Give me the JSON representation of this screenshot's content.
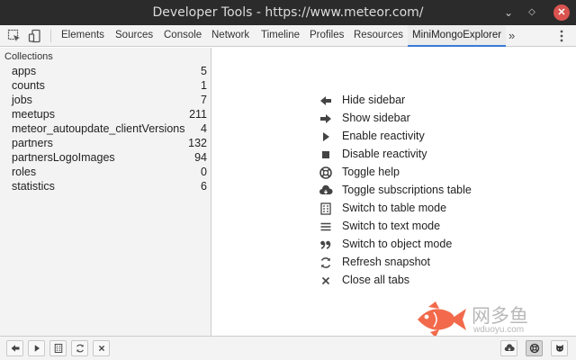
{
  "window": {
    "title": "Developer Tools - https://www.meteor.com/",
    "minimize_glyph": "⌄",
    "restore_glyph": "◇",
    "close_glyph": "✕"
  },
  "tabs": {
    "items": [
      {
        "label": "Elements"
      },
      {
        "label": "Sources"
      },
      {
        "label": "Console"
      },
      {
        "label": "Network"
      },
      {
        "label": "Timeline"
      },
      {
        "label": "Profiles"
      },
      {
        "label": "Resources"
      },
      {
        "label": "MiniMongoExplorer",
        "active": true
      }
    ],
    "more_glyph": "»"
  },
  "sidebar": {
    "heading": "Collections",
    "collections": [
      {
        "name": "apps",
        "count": "5"
      },
      {
        "name": "counts",
        "count": "1"
      },
      {
        "name": "jobs",
        "count": "7"
      },
      {
        "name": "meetups",
        "count": "211"
      },
      {
        "name": "meteor_autoupdate_clientVersions",
        "count": "4"
      },
      {
        "name": "partners",
        "count": "132"
      },
      {
        "name": "partnersLogoImages",
        "count": "94"
      },
      {
        "name": "roles",
        "count": "0"
      },
      {
        "name": "statistics",
        "count": "6"
      }
    ]
  },
  "help": {
    "items": [
      {
        "icon": "arrow-left-icon",
        "label": "Hide sidebar"
      },
      {
        "icon": "arrow-right-icon",
        "label": "Show sidebar"
      },
      {
        "icon": "play-icon",
        "label": "Enable reactivity"
      },
      {
        "icon": "stop-icon",
        "label": "Disable reactivity"
      },
      {
        "icon": "lifebuoy-icon",
        "label": "Toggle help"
      },
      {
        "icon": "cloud-download-icon",
        "label": "Toggle subscriptions table"
      },
      {
        "icon": "table-icon",
        "label": "Switch to table mode"
      },
      {
        "icon": "text-lines-icon",
        "label": "Switch to text mode"
      },
      {
        "icon": "quote-icon",
        "label": "Switch to object mode"
      },
      {
        "icon": "refresh-icon",
        "label": "Refresh snapshot"
      },
      {
        "icon": "close-icon",
        "label": "Close all tabs"
      }
    ]
  },
  "watermark": {
    "text": "网多鱼",
    "subtext": "wduoyu.com"
  },
  "bottom_toolbar": {
    "left": [
      "arrow-left-icon",
      "play-icon",
      "table-icon",
      "refresh-icon",
      "close-icon"
    ],
    "right": [
      "cloud-download-icon",
      "lifebuoy-icon",
      "github-icon"
    ],
    "pressed": "lifebuoy-icon"
  },
  "colors": {
    "titlebar": "#2b2b2b",
    "close_button": "#d9534f",
    "active_tab_underline": "#3879d9",
    "watermark_fish": "#f26a4b"
  }
}
